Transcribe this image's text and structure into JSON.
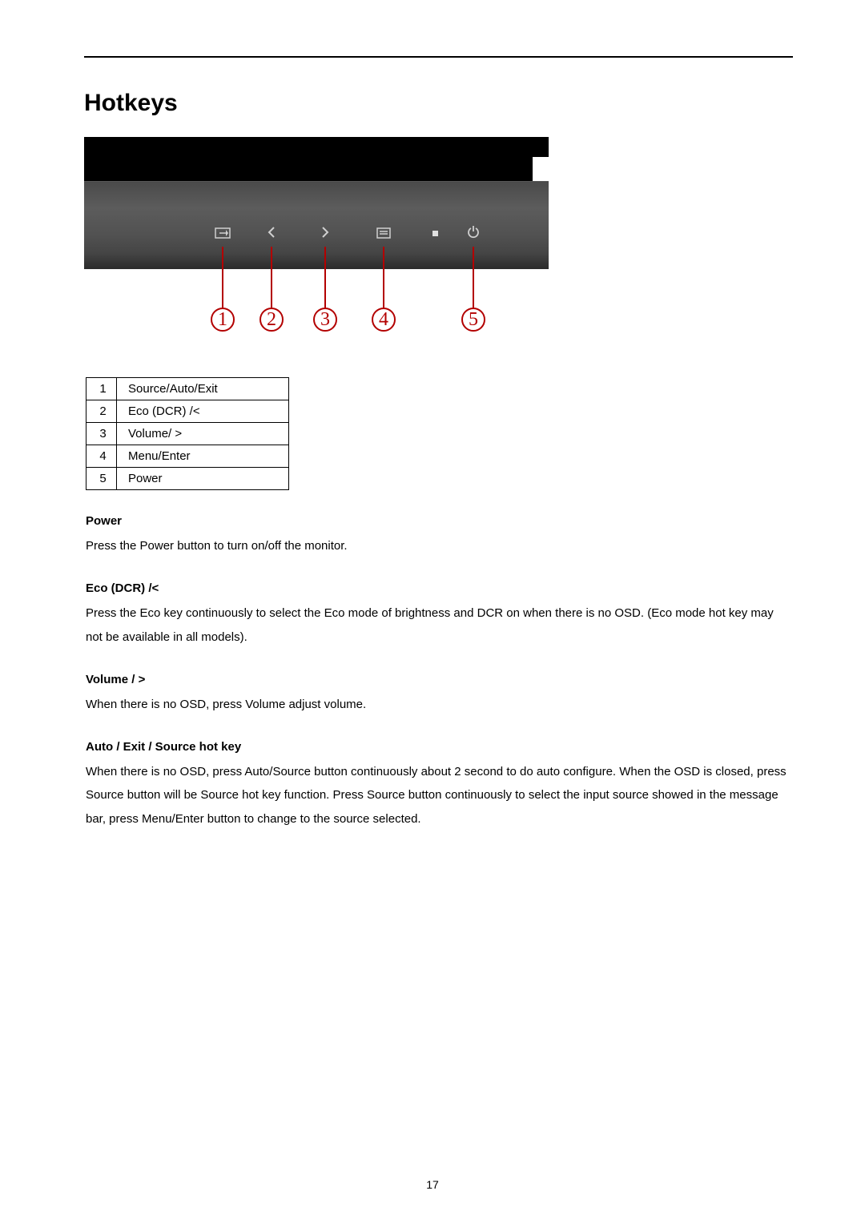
{
  "title": "Hotkeys",
  "page_number": "17",
  "callouts": [
    "1",
    "2",
    "3",
    "4",
    "5"
  ],
  "icons": {
    "source": "source-icon",
    "left": "chevron-left-icon",
    "right": "chevron-right-icon",
    "menu": "menu-icon",
    "power": "power-icon"
  },
  "table_rows": [
    {
      "num": "1",
      "label": "Source/Auto/Exit"
    },
    {
      "num": "2",
      "label": "Eco (DCR) /<"
    },
    {
      "num": "3",
      "label": "Volume/ >"
    },
    {
      "num": "4",
      "label": "Menu/Enter"
    },
    {
      "num": "5",
      "label": "Power"
    }
  ],
  "sections": [
    {
      "heading": "Power",
      "body": "Press the Power button to turn on/off the monitor."
    },
    {
      "heading": "Eco (DCR) /<",
      "body": "Press the Eco key continuously to select the Eco mode of brightness and DCR on when there is no OSD. (Eco mode hot key may not be available in all models)."
    },
    {
      "heading": "Volume / >",
      "body": "When there is no OSD, press Volume adjust volume."
    },
    {
      "heading": "Auto / Exit / Source hot key",
      "body": "When there is no OSD, press Auto/Source button continuously about 2 second to do auto configure. When the OSD is closed, press Source button will be Source hot key function. Press Source button continuously to select the input source showed in the message bar, press Menu/Enter button to change to the source selected."
    }
  ]
}
